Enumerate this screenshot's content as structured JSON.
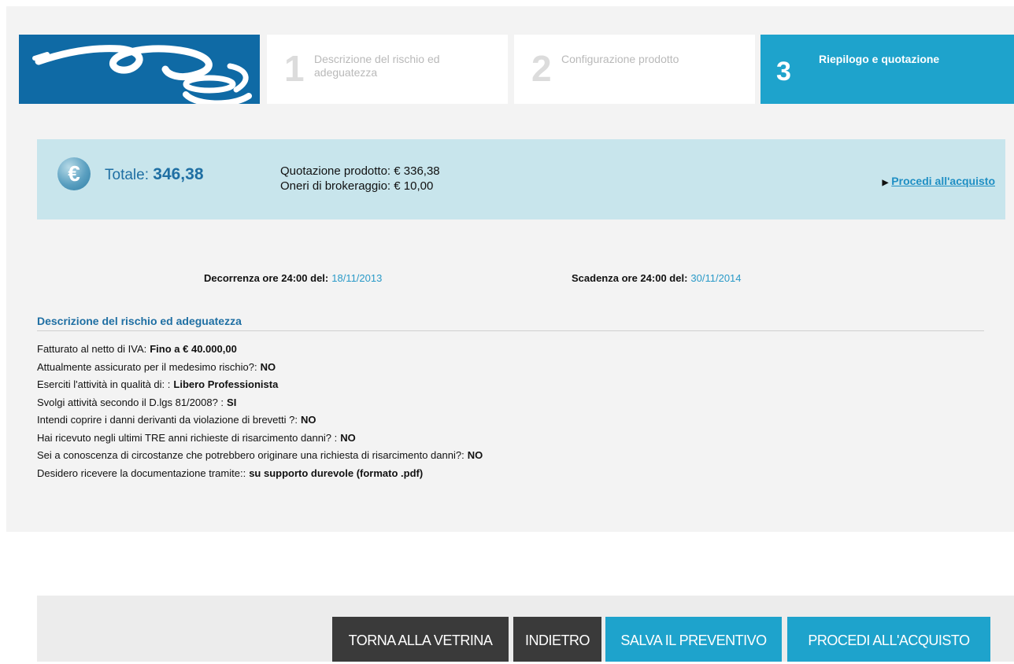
{
  "steps": [
    {
      "num": "1",
      "label": "Descrizione del rischio ed adeguatezza"
    },
    {
      "num": "2",
      "label": "Configurazione prodotto"
    },
    {
      "num": "3",
      "label": "Riepilogo e quotazione"
    }
  ],
  "totals": {
    "euro_symbol": "€",
    "total_label": "Totale:",
    "total_value": "346,38",
    "quote_line": "Quotazione prodotto: € 336,38",
    "brokerage_line": "Oneri di brokeraggio: € 10,00",
    "buy_link": "Procedi all'acquisto"
  },
  "dates": {
    "start_label": "Decorrenza ore 24:00 del:",
    "start_value": "18/11/2013",
    "end_label": "Scadenza ore 24:00 del:",
    "end_value": "30/11/2014"
  },
  "section_title": "Descrizione del rischio ed adeguatezza",
  "facts": [
    {
      "q": "Fatturato al netto di IVA:",
      "a": "Fino a € 40.000,00"
    },
    {
      "q": "Attualmente assicurato per il medesimo rischio?:",
      "a": "NO"
    },
    {
      "q": "Eserciti l'attività in qualità di: :",
      "a": "Libero Professionista"
    },
    {
      "q": "Svolgi attività secondo il D.lgs 81/2008? :",
      "a": "SI"
    },
    {
      "q": "Intendi coprire i danni derivanti da violazione di brevetti ?:",
      "a": "NO"
    },
    {
      "q": "Hai ricevuto negli ultimi TRE anni richieste di risarcimento danni? :",
      "a": "NO"
    },
    {
      "q": "Sei a conoscenza di circostanze che potrebbero originare una richiesta di risarcimento danni?:",
      "a": "NO"
    },
    {
      "q": "Desidero ricevere la documentazione tramite::",
      "a": "su supporto durevole (formato .pdf)"
    }
  ],
  "buttons": {
    "back_to_store": "TORNA ALLA VETRINA",
    "back": "INDIETRO",
    "save_quote": "SALVA IL PREVENTIVO",
    "proceed": "PROCEDI ALL'ACQUISTO"
  },
  "colors": {
    "brand_blue": "#0f6aa5",
    "accent_cyan": "#1ea3cc",
    "total_box": "#c8e5ec",
    "dark_button": "#3a3a3a"
  }
}
